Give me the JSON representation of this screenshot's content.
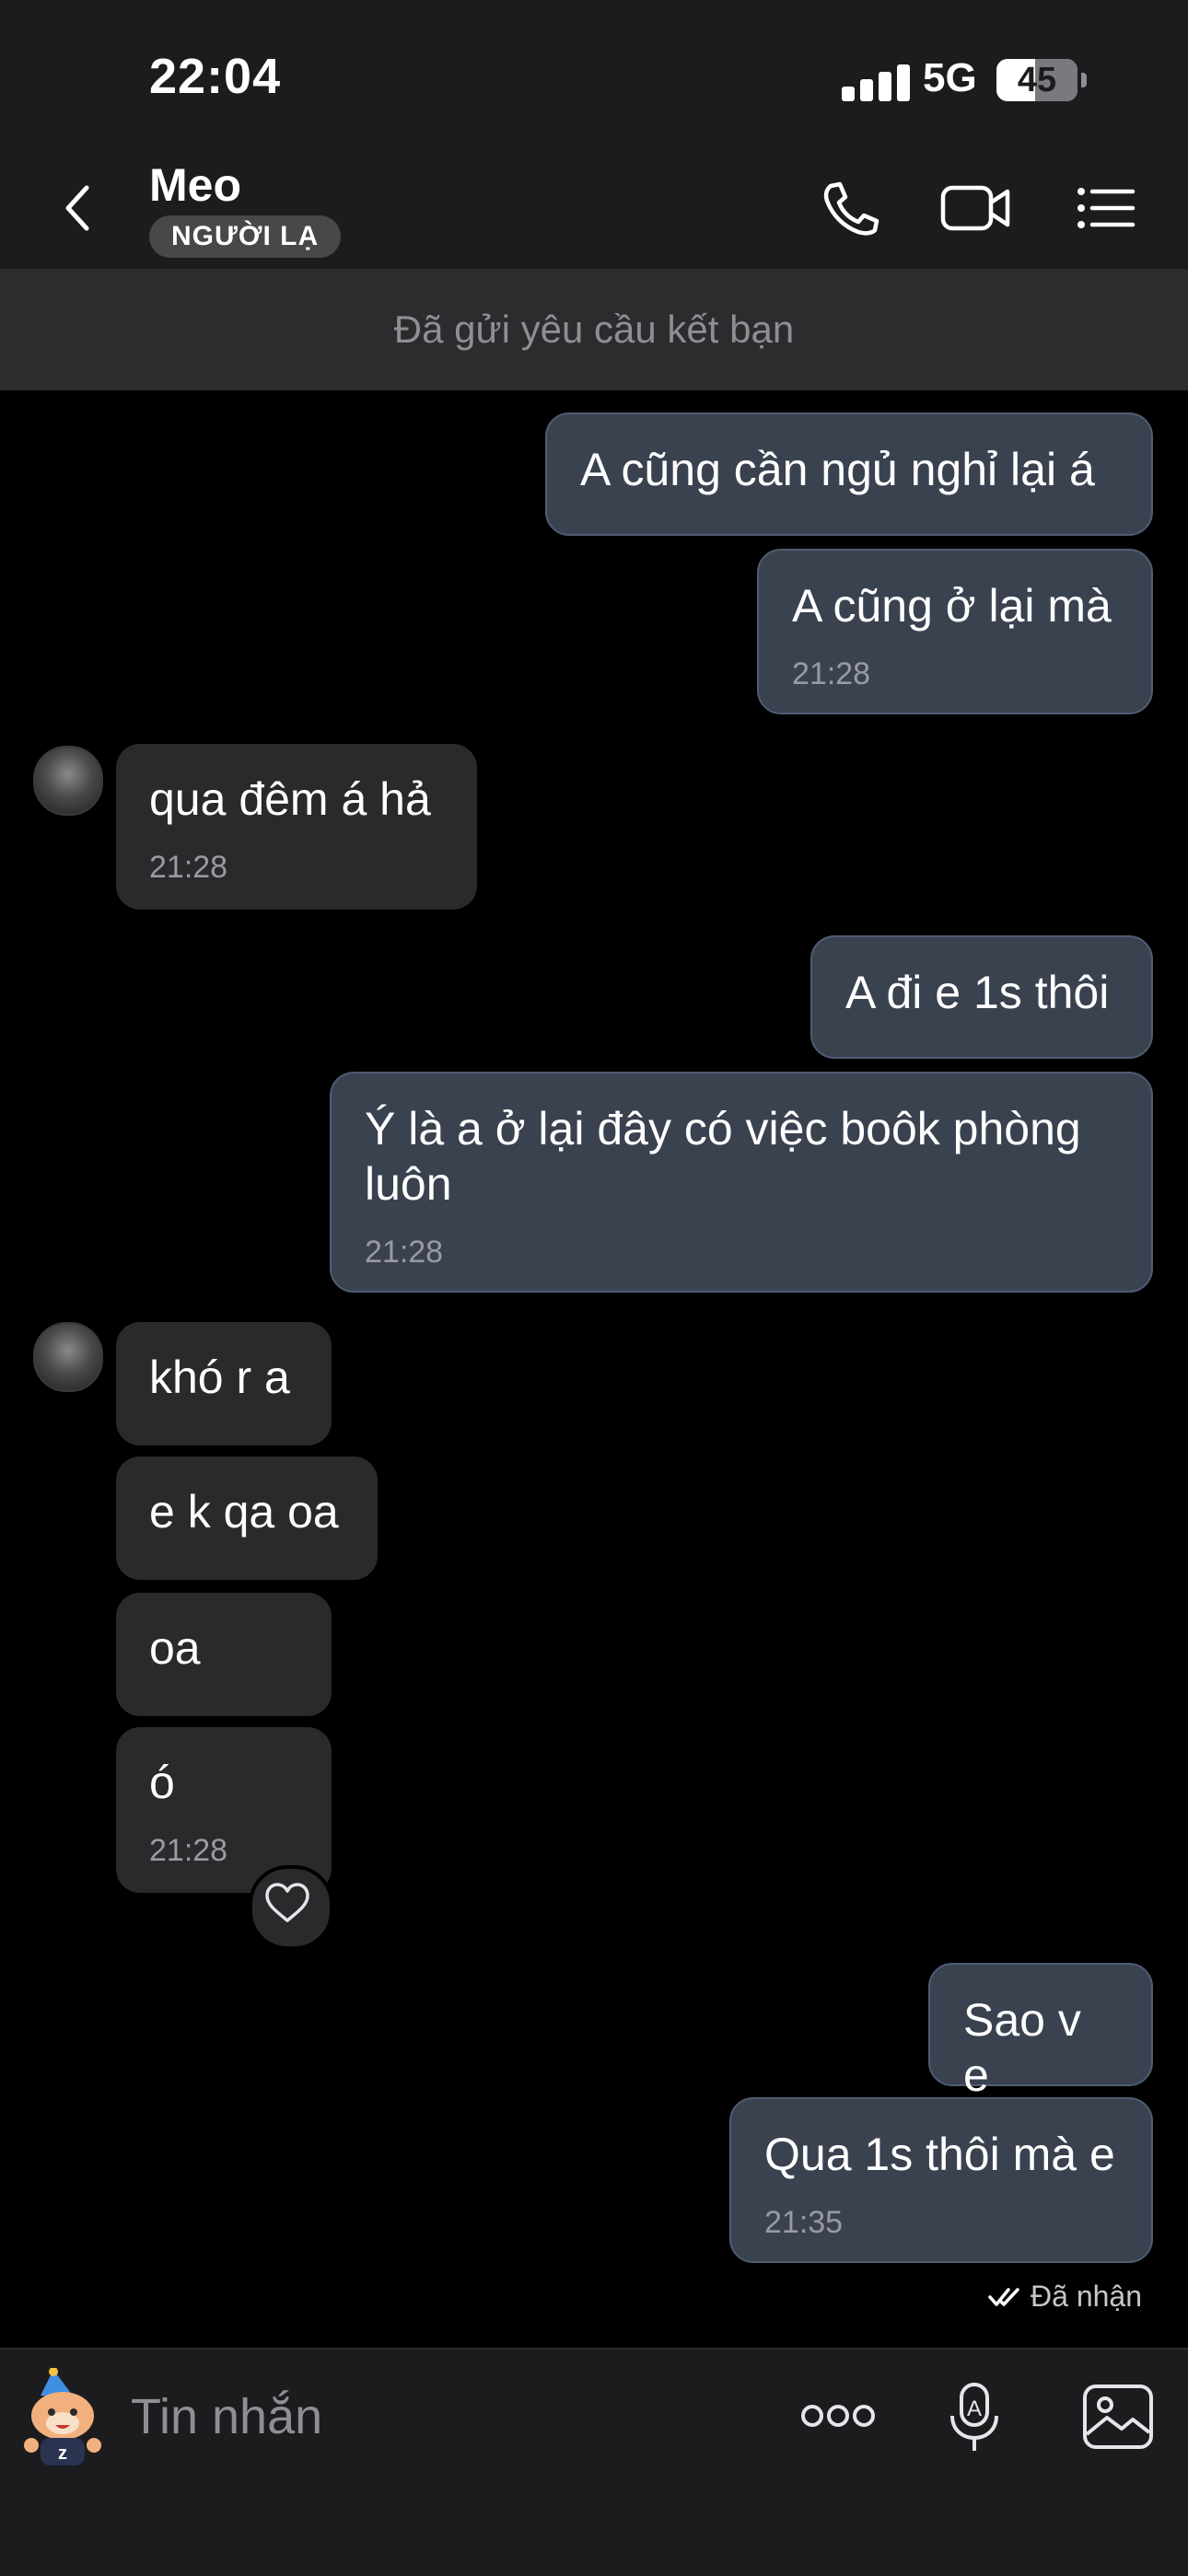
{
  "status": {
    "time": "22:04",
    "network": "5G",
    "battery": "45"
  },
  "header": {
    "name": "Meo",
    "badge": "NGƯỜI LẠ"
  },
  "banner": "Đã gửi yêu cầu kết bạn",
  "messages": [
    {
      "dir": "out",
      "text": "A cũng cần ngủ nghỉ lại á",
      "time": ""
    },
    {
      "dir": "out",
      "text": "A cũng ở lại mà",
      "time": "21:28"
    },
    {
      "dir": "in",
      "text": "qua đêm á hả",
      "time": "21:28"
    },
    {
      "dir": "out",
      "text": "A đi e 1s thôi",
      "time": ""
    },
    {
      "dir": "out",
      "text": "Ý là a ở lại đây có việc boôk phòng luôn",
      "time": "21:28"
    },
    {
      "dir": "in",
      "text": "khó r a",
      "time": ""
    },
    {
      "dir": "in",
      "text": "e k qa oa",
      "time": ""
    },
    {
      "dir": "in",
      "text": "oa",
      "time": ""
    },
    {
      "dir": "in",
      "text": "ó",
      "time": "21:28"
    },
    {
      "dir": "out",
      "text": "Sao v e",
      "time": ""
    },
    {
      "dir": "out",
      "text": "Qua 1s thôi mà e",
      "time": "21:35"
    }
  ],
  "receipt": "Đã nhận",
  "input": {
    "placeholder": "Tin nhắn"
  },
  "colors": {
    "outgoing_bubble": "#3a4250",
    "incoming_bubble": "#2a2a2c",
    "background": "#000000",
    "bar": "#1c1c1e"
  },
  "icons": [
    "back-icon",
    "phone-icon",
    "video-call-icon",
    "menu-list-icon",
    "heart-icon",
    "double-check-icon",
    "sticker-icon",
    "more-icon",
    "voice-to-text-icon",
    "image-icon"
  ]
}
